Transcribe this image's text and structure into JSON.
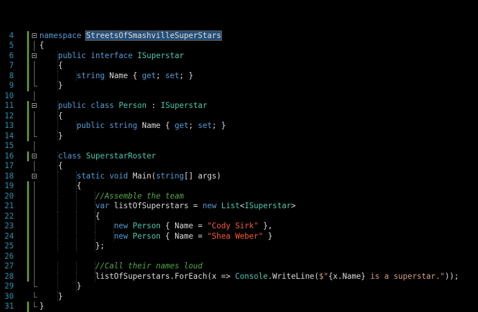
{
  "editor": {
    "colors": {
      "background": "#000000",
      "line_number": "#2b91af",
      "keyword": "#569cd6",
      "type": "#4ec9b0",
      "string": "#d69d85",
      "comment": "#57a64a",
      "plain": "#dcdcdc",
      "change_marker": "#5c8a2a"
    },
    "lines": [
      {
        "n": "4",
        "indent": 0,
        "fold": "open",
        "chg": true,
        "tokens": [
          {
            "t": "kw",
            "s": "namespace"
          },
          {
            "t": "pl",
            "s": " "
          },
          {
            "t": "hl",
            "s": "StreetsOfSmashvilleSuperStars"
          }
        ]
      },
      {
        "n": "5",
        "indent": 0,
        "fold": "line",
        "chg": true,
        "tokens": [
          {
            "t": "pl",
            "s": "{"
          }
        ]
      },
      {
        "n": "6",
        "indent": 1,
        "fold": "open",
        "chg": true,
        "tokens": [
          {
            "t": "kw",
            "s": "public"
          },
          {
            "t": "pl",
            "s": " "
          },
          {
            "t": "kw",
            "s": "interface"
          },
          {
            "t": "pl",
            "s": " "
          },
          {
            "t": "ty",
            "s": "ISuperstar"
          }
        ]
      },
      {
        "n": "7",
        "indent": 1,
        "fold": "line",
        "chg": true,
        "tokens": [
          {
            "t": "pl",
            "s": "{"
          }
        ]
      },
      {
        "n": "8",
        "indent": 2,
        "fold": "line",
        "chg": true,
        "tokens": [
          {
            "t": "kw",
            "s": "string"
          },
          {
            "t": "pl",
            "s": " Name { "
          },
          {
            "t": "kw",
            "s": "get"
          },
          {
            "t": "pl",
            "s": "; "
          },
          {
            "t": "kw",
            "s": "set"
          },
          {
            "t": "pl",
            "s": "; }"
          }
        ]
      },
      {
        "n": "9",
        "indent": 1,
        "fold": "end",
        "chg": true,
        "tokens": [
          {
            "t": "pl",
            "s": "}"
          }
        ]
      },
      {
        "n": "10",
        "indent": 0,
        "fold": "line",
        "chg": false,
        "tokens": []
      },
      {
        "n": "11",
        "indent": 1,
        "fold": "open",
        "chg": true,
        "tokens": [
          {
            "t": "kw",
            "s": "public"
          },
          {
            "t": "pl",
            "s": " "
          },
          {
            "t": "kw",
            "s": "class"
          },
          {
            "t": "pl",
            "s": " "
          },
          {
            "t": "ty",
            "s": "Person"
          },
          {
            "t": "pl",
            "s": " : "
          },
          {
            "t": "ty",
            "s": "ISuperstar"
          }
        ]
      },
      {
        "n": "12",
        "indent": 1,
        "fold": "line",
        "chg": true,
        "tokens": [
          {
            "t": "pl",
            "s": "{"
          }
        ]
      },
      {
        "n": "13",
        "indent": 2,
        "fold": "line",
        "chg": true,
        "tokens": [
          {
            "t": "kw",
            "s": "public"
          },
          {
            "t": "pl",
            "s": " "
          },
          {
            "t": "kw",
            "s": "string"
          },
          {
            "t": "pl",
            "s": " Name { "
          },
          {
            "t": "kw",
            "s": "get"
          },
          {
            "t": "pl",
            "s": "; "
          },
          {
            "t": "kw",
            "s": "set"
          },
          {
            "t": "pl",
            "s": "; }"
          }
        ]
      },
      {
        "n": "14",
        "indent": 1,
        "fold": "end",
        "chg": true,
        "tokens": [
          {
            "t": "pl",
            "s": "}"
          }
        ]
      },
      {
        "n": "15",
        "indent": 0,
        "fold": "line",
        "chg": false,
        "tokens": []
      },
      {
        "n": "16",
        "indent": 1,
        "fold": "open",
        "chg": true,
        "tokens": [
          {
            "t": "kw",
            "s": "class"
          },
          {
            "t": "pl",
            "s": " "
          },
          {
            "t": "ty",
            "s": "SuperstarRoster"
          }
        ]
      },
      {
        "n": "17",
        "indent": 1,
        "fold": "line",
        "chg": false,
        "tokens": [
          {
            "t": "pl",
            "s": "{"
          }
        ]
      },
      {
        "n": "18",
        "indent": 2,
        "fold": "open",
        "chg": false,
        "tokens": [
          {
            "t": "kw",
            "s": "static"
          },
          {
            "t": "pl",
            "s": " "
          },
          {
            "t": "kw",
            "s": "void"
          },
          {
            "t": "pl",
            "s": " Main("
          },
          {
            "t": "kw",
            "s": "string"
          },
          {
            "t": "pl",
            "s": "[] args)"
          }
        ]
      },
      {
        "n": "19",
        "indent": 2,
        "fold": "line",
        "chg": true,
        "tokens": [
          {
            "t": "pl",
            "s": "{"
          }
        ]
      },
      {
        "n": "20",
        "indent": 3,
        "fold": "line",
        "chg": true,
        "tokens": [
          {
            "t": "cm",
            "s": "//Assemble the team"
          }
        ]
      },
      {
        "n": "21",
        "indent": 3,
        "fold": "line",
        "chg": true,
        "tokens": [
          {
            "t": "kw",
            "s": "var"
          },
          {
            "t": "pl",
            "s": " listOfSuperstars = "
          },
          {
            "t": "kw",
            "s": "new"
          },
          {
            "t": "pl",
            "s": " "
          },
          {
            "t": "ty",
            "s": "List"
          },
          {
            "t": "pl",
            "s": "<"
          },
          {
            "t": "ty",
            "s": "ISuperstar"
          },
          {
            "t": "pl",
            "s": ">"
          }
        ]
      },
      {
        "n": "22",
        "indent": 3,
        "fold": "line",
        "chg": true,
        "tokens": [
          {
            "t": "pl",
            "s": "{"
          }
        ]
      },
      {
        "n": "23",
        "indent": 4,
        "fold": "line",
        "chg": true,
        "tokens": [
          {
            "t": "kw",
            "s": "new"
          },
          {
            "t": "pl",
            "s": " "
          },
          {
            "t": "ty",
            "s": "Person"
          },
          {
            "t": "pl",
            "s": " { Name = "
          },
          {
            "t": "red",
            "s": "\"Cody Sirk\""
          },
          {
            "t": "pl",
            "s": " },"
          }
        ]
      },
      {
        "n": "24",
        "indent": 4,
        "fold": "line",
        "chg": true,
        "tokens": [
          {
            "t": "kw",
            "s": "new"
          },
          {
            "t": "pl",
            "s": " "
          },
          {
            "t": "ty",
            "s": "Person"
          },
          {
            "t": "pl",
            "s": " { Name = "
          },
          {
            "t": "red",
            "s": "\"Shea Weber\""
          },
          {
            "t": "pl",
            "s": " }"
          }
        ]
      },
      {
        "n": "25",
        "indent": 3,
        "fold": "line",
        "chg": true,
        "tokens": [
          {
            "t": "pl",
            "s": "};"
          }
        ]
      },
      {
        "n": "26",
        "indent": 0,
        "fold": "line",
        "chg": true,
        "tokens": []
      },
      {
        "n": "27",
        "indent": 3,
        "fold": "line",
        "chg": true,
        "tokens": [
          {
            "t": "cm",
            "s": "//Call their names loud"
          }
        ]
      },
      {
        "n": "28",
        "indent": 3,
        "fold": "line",
        "chg": true,
        "tokens": [
          {
            "t": "pl",
            "s": "listOfSuperstars.ForEach(x => "
          },
          {
            "t": "ty",
            "s": "Console"
          },
          {
            "t": "pl",
            "s": ".WriteLine("
          },
          {
            "t": "str",
            "s": "$\""
          },
          {
            "t": "pl",
            "s": "{x.Name}"
          },
          {
            "t": "str",
            "s": " is a superstar.\""
          },
          {
            "t": "pl",
            "s": "));"
          }
        ]
      },
      {
        "n": "29",
        "indent": 2,
        "fold": "end",
        "chg": false,
        "tokens": [
          {
            "t": "pl",
            "s": "}"
          }
        ]
      },
      {
        "n": "30",
        "indent": 1,
        "fold": "end",
        "chg": false,
        "tokens": [
          {
            "t": "pl",
            "s": "}"
          }
        ]
      },
      {
        "n": "31",
        "indent": 0,
        "fold": "end",
        "chg": true,
        "tokens": [
          {
            "t": "pl",
            "s": "}"
          }
        ]
      }
    ]
  }
}
